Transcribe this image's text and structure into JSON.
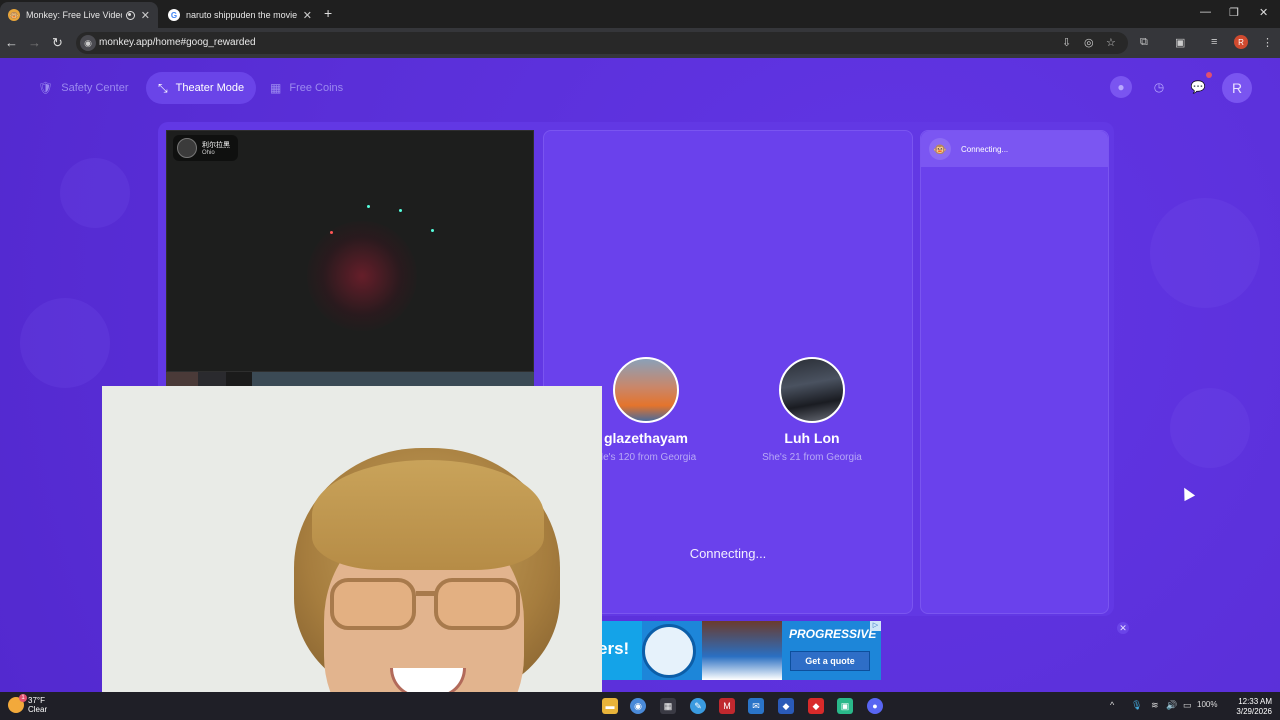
{
  "browser": {
    "tabs": [
      {
        "title": "Monkey: Free Live Video Ch",
        "active": true
      },
      {
        "title": "naruto shippuden the movie - G",
        "active": false
      }
    ],
    "url": "monkey.app/home#goog_rewarded",
    "profile_initial": "R"
  },
  "nav": {
    "safety_center": "Safety Center",
    "theater_mode": "Theater Mode",
    "free_coins": "Free Coins",
    "avatar_initial": "R",
    "notification_count": "1"
  },
  "self_video": {
    "username": "利尔拉黑",
    "location": "Ohio"
  },
  "matches": [
    {
      "name": "glazethayam",
      "subtitle": "He's 120 from Georgia"
    },
    {
      "name": "Luh Lon",
      "subtitle": "She's 21 from Georgia"
    }
  ],
  "status": {
    "main": "Connecting...",
    "side": "Connecting..."
  },
  "ad": {
    "partial_text": "ers!",
    "brand": "PROGRESSIVE",
    "cta": "Get a quote",
    "choice": "▷"
  },
  "taskbar": {
    "temperature": "37°F",
    "condition": "Clear",
    "weather_badge": "1",
    "battery": "100%",
    "time": "12:33 AM",
    "date": "3/29/2026"
  },
  "colors": {
    "page_bg": "#5b30d6",
    "panel": "#6a41ec",
    "accent_selected": "#6a44e8"
  }
}
